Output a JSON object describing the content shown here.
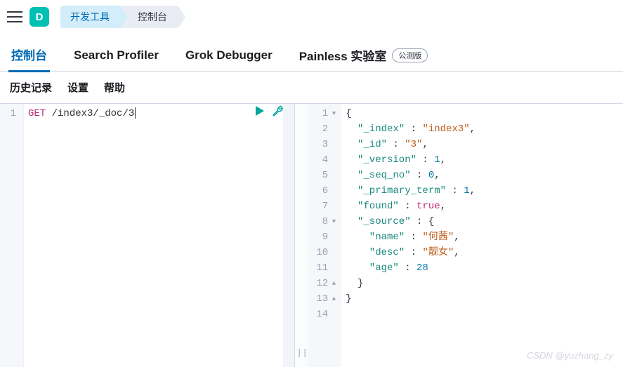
{
  "header": {
    "app_badge": "D",
    "crumbs": [
      "开发工具",
      "控制台"
    ]
  },
  "tabs": [
    {
      "label": "控制台",
      "active": true
    },
    {
      "label": "Search Profiler",
      "active": false
    },
    {
      "label": "Grok Debugger",
      "active": false
    },
    {
      "label": "Painless 实验室",
      "active": false,
      "badge": "公测版"
    }
  ],
  "subnav": [
    "历史记录",
    "设置",
    "帮助"
  ],
  "request": {
    "line_no": "1",
    "method": "GET",
    "path": "/index3/_doc/3"
  },
  "response": {
    "lines": [
      {
        "n": "1",
        "fold": "down",
        "text_parts": [
          [
            "punc",
            "{"
          ]
        ]
      },
      {
        "n": "2",
        "text_parts": [
          [
            "indent",
            "  "
          ],
          [
            "key",
            "\"_index\""
          ],
          [
            "punc",
            " : "
          ],
          [
            "str",
            "\"index3\""
          ],
          [
            "punc",
            ","
          ]
        ]
      },
      {
        "n": "3",
        "text_parts": [
          [
            "indent",
            "  "
          ],
          [
            "key",
            "\"_id\""
          ],
          [
            "punc",
            " : "
          ],
          [
            "str",
            "\"3\""
          ],
          [
            "punc",
            ","
          ]
        ]
      },
      {
        "n": "4",
        "text_parts": [
          [
            "indent",
            "  "
          ],
          [
            "key",
            "\"_version\""
          ],
          [
            "punc",
            " : "
          ],
          [
            "num",
            "1"
          ],
          [
            "punc",
            ","
          ]
        ]
      },
      {
        "n": "5",
        "text_parts": [
          [
            "indent",
            "  "
          ],
          [
            "key",
            "\"_seq_no\""
          ],
          [
            "punc",
            " : "
          ],
          [
            "num",
            "0"
          ],
          [
            "punc",
            ","
          ]
        ]
      },
      {
        "n": "6",
        "text_parts": [
          [
            "indent",
            "  "
          ],
          [
            "key",
            "\"_primary_term\""
          ],
          [
            "punc",
            " : "
          ],
          [
            "num",
            "1"
          ],
          [
            "punc",
            ","
          ]
        ]
      },
      {
        "n": "7",
        "text_parts": [
          [
            "indent",
            "  "
          ],
          [
            "key",
            "\"found\""
          ],
          [
            "punc",
            " : "
          ],
          [
            "bool",
            "true"
          ],
          [
            "punc",
            ","
          ]
        ]
      },
      {
        "n": "8",
        "fold": "down",
        "text_parts": [
          [
            "indent",
            "  "
          ],
          [
            "key",
            "\"_source\""
          ],
          [
            "punc",
            " : {"
          ]
        ]
      },
      {
        "n": "9",
        "text_parts": [
          [
            "indent",
            "    "
          ],
          [
            "key",
            "\"name\""
          ],
          [
            "punc",
            " : "
          ],
          [
            "str",
            "\"何茜\""
          ],
          [
            "punc",
            ","
          ]
        ]
      },
      {
        "n": "10",
        "text_parts": [
          [
            "indent",
            "    "
          ],
          [
            "key",
            "\"desc\""
          ],
          [
            "punc",
            " : "
          ],
          [
            "str",
            "\"靓女\""
          ],
          [
            "punc",
            ","
          ]
        ]
      },
      {
        "n": "11",
        "text_parts": [
          [
            "indent",
            "    "
          ],
          [
            "key",
            "\"age\""
          ],
          [
            "punc",
            " : "
          ],
          [
            "num",
            "28"
          ]
        ]
      },
      {
        "n": "12",
        "fold": "up",
        "text_parts": [
          [
            "indent",
            "  "
          ],
          [
            "punc",
            "}"
          ]
        ]
      },
      {
        "n": "13",
        "fold": "up",
        "text_parts": [
          [
            "punc",
            "}"
          ]
        ]
      },
      {
        "n": "14",
        "text_parts": []
      }
    ]
  },
  "watermark": "CSDN @yuzhang_zy"
}
